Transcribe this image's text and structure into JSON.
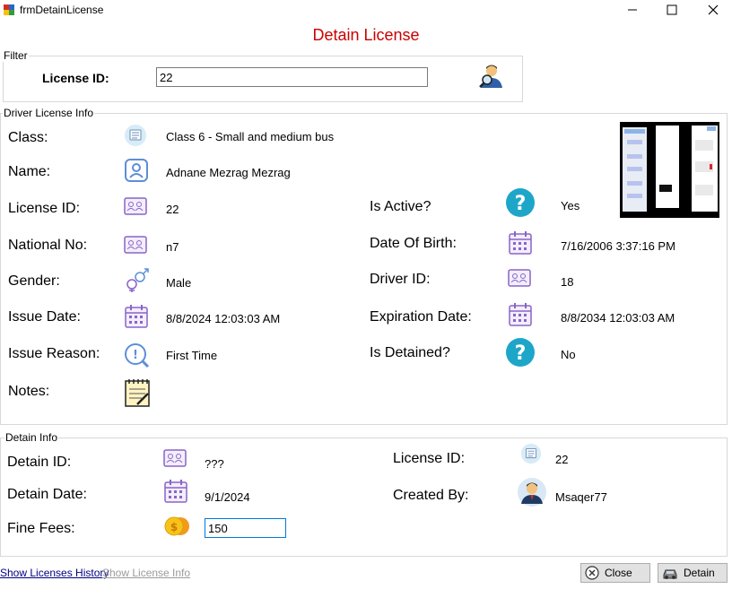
{
  "window": {
    "title": "frmDetainLicense"
  },
  "form": {
    "title": "Detain License"
  },
  "filter": {
    "group_label": "Filter",
    "license_id_label": "License ID:",
    "license_id_value": "22"
  },
  "driver_info": {
    "group_label": "Driver License Info",
    "class_label": "Class:",
    "class_value": "Class 6 - Small and medium bus",
    "name_label": "Name:",
    "name_value": "Adnane Mezrag  Mezrag",
    "license_id_label": "License ID:",
    "license_id_value": "22",
    "national_no_label": "National No:",
    "national_no_value": "n7",
    "gender_label": "Gender:",
    "gender_value": "Male",
    "issue_date_label": "Issue Date:",
    "issue_date_value": "8/8/2024 12:03:03 AM",
    "issue_reason_label": "Issue Reason:",
    "issue_reason_value": "First Time",
    "notes_label": "Notes:",
    "is_active_label": "Is Active?",
    "is_active_value": "Yes",
    "dob_label": "Date Of Birth:",
    "dob_value": "7/16/2006 3:37:16 PM",
    "driver_id_label": "Driver ID:",
    "driver_id_value": "18",
    "expiration_label": "Expiration Date:",
    "expiration_value": "8/8/2034 12:03:03 AM",
    "is_detained_label": "Is Detained?",
    "is_detained_value": "No"
  },
  "detain_info": {
    "group_label": "Detain Info",
    "detain_id_label": "Detain ID:",
    "detain_id_value": "???",
    "detain_date_label": "Detain Date:",
    "detain_date_value": "9/1/2024",
    "fine_fees_label": "Fine Fees:",
    "fine_fees_value": "150",
    "license_id_label": "License ID:",
    "license_id_value": "22",
    "created_by_label": "Created By:",
    "created_by_value": "Msaqer77"
  },
  "footer": {
    "show_licenses_history": "Show Licenses History",
    "show_license_info": "Show License Info",
    "close_label": "Close",
    "detain_label": "Detain"
  },
  "colors": {
    "title_red": "#cc0000",
    "link_blue": "#000080",
    "disabled_gray": "#9b9b9b",
    "icon_teal": "#1ea6c9",
    "icon_purple": "#8a64c8"
  }
}
